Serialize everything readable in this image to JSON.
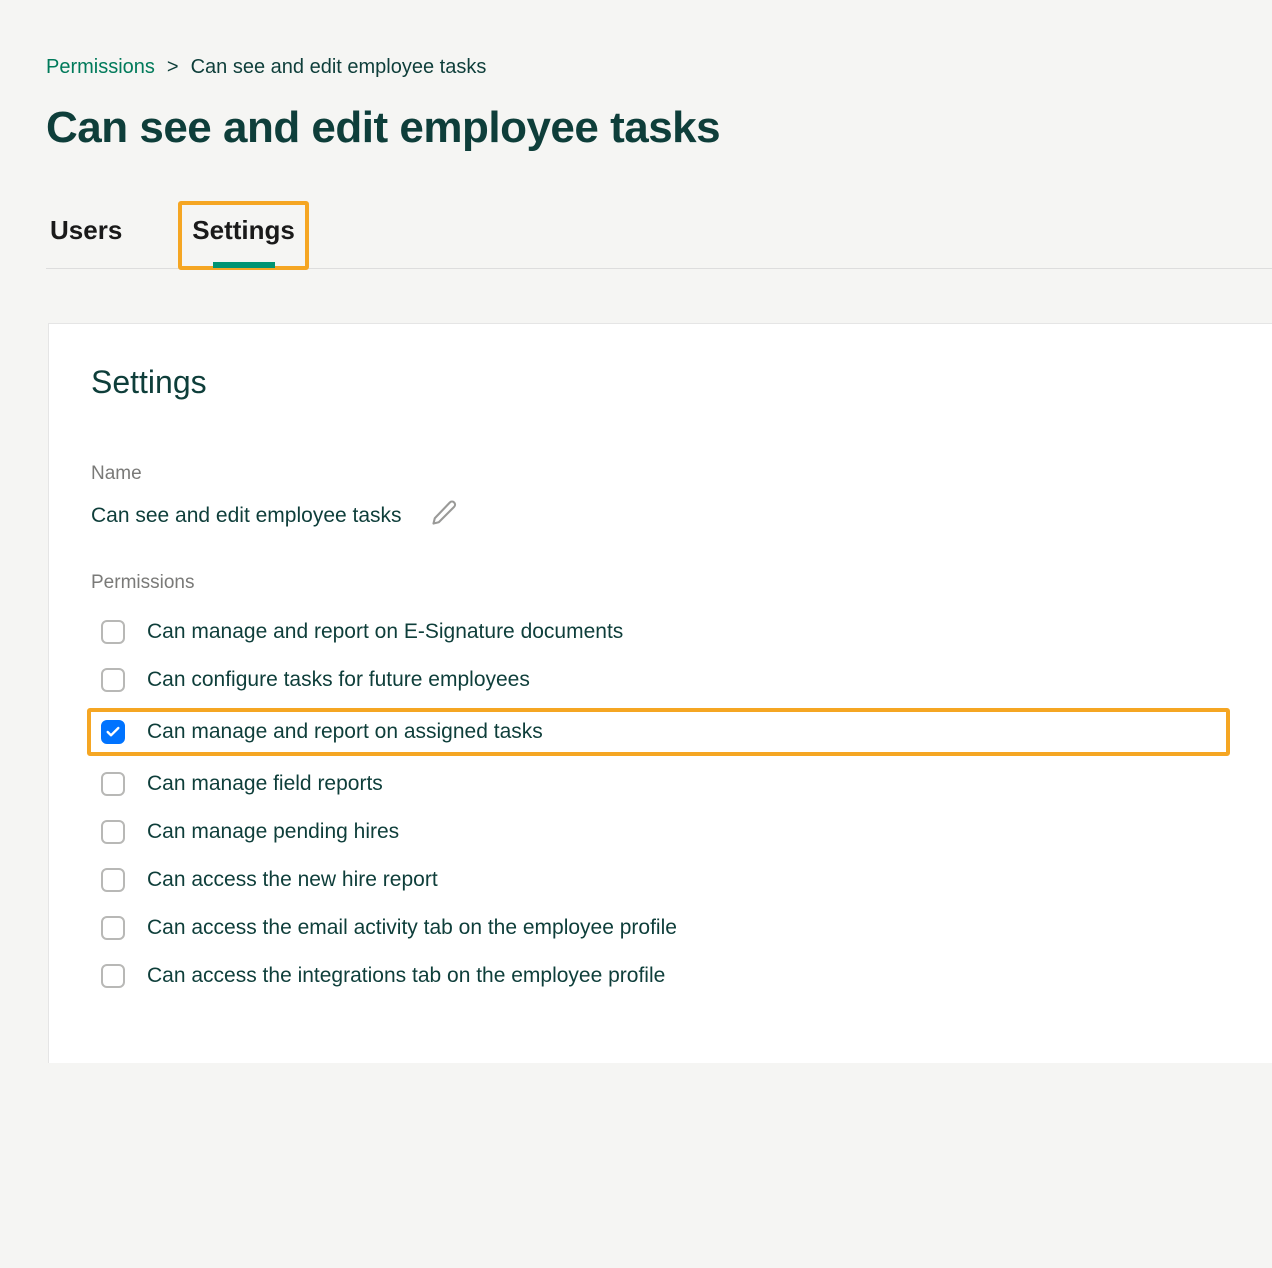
{
  "breadcrumb": {
    "root": "Permissions",
    "separator": ">",
    "current": "Can see and edit employee tasks"
  },
  "page_title": "Can see and edit employee tasks",
  "tabs": [
    {
      "label": "Users",
      "active": false
    },
    {
      "label": "Settings",
      "active": true,
      "highlighted": true
    }
  ],
  "panel": {
    "title": "Settings",
    "name_label": "Name",
    "name_value": "Can see and edit employee tasks",
    "permissions_label": "Permissions",
    "permissions": [
      {
        "label": "Can manage and report on E-Signature documents",
        "checked": false,
        "highlighted": false
      },
      {
        "label": "Can configure tasks for future employees",
        "checked": false,
        "highlighted": false
      },
      {
        "label": "Can manage and report on assigned tasks",
        "checked": true,
        "highlighted": true
      },
      {
        "label": "Can manage field reports",
        "checked": false,
        "highlighted": false
      },
      {
        "label": "Can manage pending hires",
        "checked": false,
        "highlighted": false
      },
      {
        "label": "Can access the new hire report",
        "checked": false,
        "highlighted": false
      },
      {
        "label": "Can access the email activity tab on the employee profile",
        "checked": false,
        "highlighted": false
      },
      {
        "label": "Can access the integrations tab on the employee profile",
        "checked": false,
        "highlighted": false
      }
    ]
  }
}
